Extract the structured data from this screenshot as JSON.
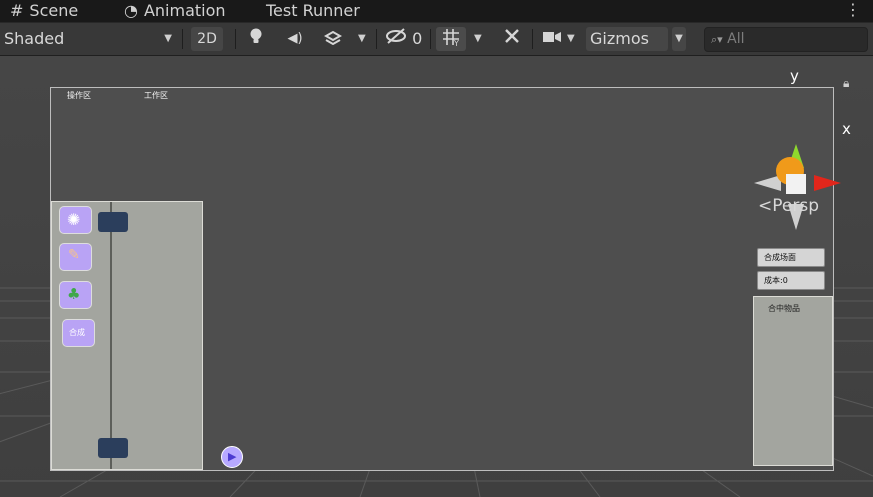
{
  "tabs": [
    {
      "label": "Scene",
      "icon": "grid-hash-icon"
    },
    {
      "label": "Animation",
      "icon": "pie-clock-icon"
    },
    {
      "label": "Test Runner",
      "icon": ""
    }
  ],
  "toolbar": {
    "shading_mode": "Shaded",
    "mode_2d": "2D",
    "hidden_count": "0",
    "gizmos_label": "Gizmos",
    "search_placeholder": "All"
  },
  "viewport": {
    "projection_label": "Persp",
    "gizmo_axes": {
      "x": "x",
      "y": "y"
    },
    "canvas_labels": {
      "left_tab_1": "操作区",
      "left_tab_2": "工作区"
    },
    "right_buttons": [
      {
        "label": "合成场面"
      },
      {
        "label": "成本:0"
      }
    ],
    "right_panel_title": "合中物品",
    "left_slot_last_label": "合成"
  },
  "colors": {
    "viewport_bg": "#464646",
    "toolbar_bg": "#383838",
    "tabbar_bg": "#191919",
    "slot_bg": "#b9a3f5",
    "panel_bg": "#a3a59f",
    "gizmo_y": "#8fd92d",
    "gizmo_x": "#e2261b",
    "gizmo_center": "#f09a1a"
  }
}
